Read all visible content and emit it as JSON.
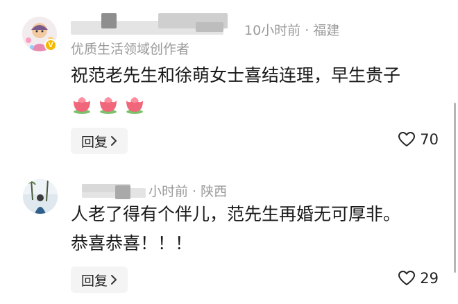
{
  "comments": [
    {
      "author_label": "优质生活领域创作者",
      "time": "10小时前",
      "location": "福建",
      "text": "祝范老先生和徐萌女士喜结连理，早生贵子",
      "emoji": [
        "tulip-emoji",
        "tulip-emoji",
        "tulip-emoji"
      ],
      "badge": "V",
      "reply_label": "回复",
      "likes": "70"
    },
    {
      "time": "小时前",
      "location": "陕西",
      "text_lines": [
        "人老了得有个伴儿，范先生再婚无可厚非。",
        "恭喜恭喜！！！"
      ],
      "reply_label": "回复",
      "likes": "29"
    }
  ],
  "separator": " · ",
  "icons": {
    "like": "heart-outline-icon",
    "chevron": "chevron-right-icon"
  },
  "colors": {
    "text": "#1a1a1a",
    "meta": "#9a9a9a",
    "reply_bg": "#f4f4f4",
    "badge": "#f5b800"
  }
}
